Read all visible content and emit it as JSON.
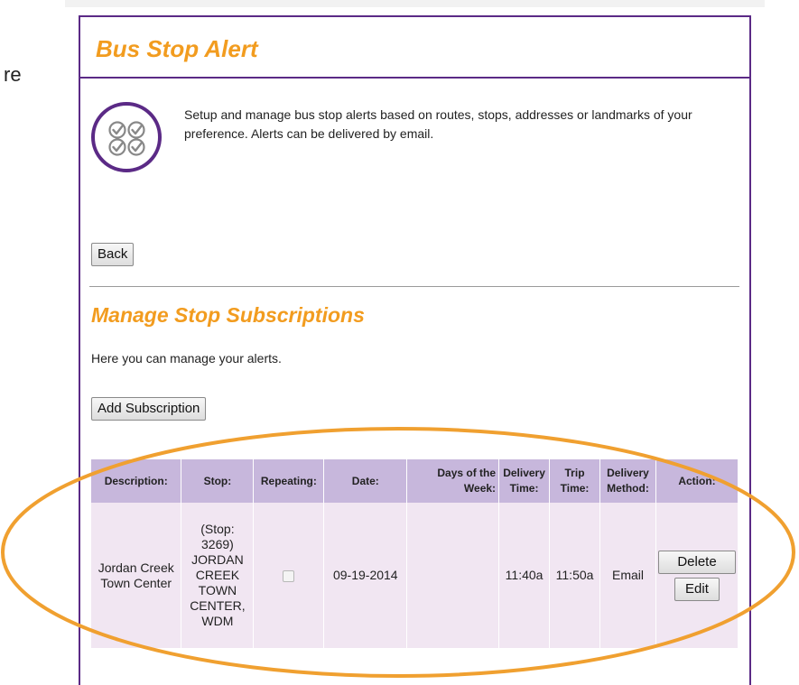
{
  "page": {
    "left_fragment": "re",
    "title": "Bus Stop Alert",
    "intro_text": "Setup and manage bus stop alerts based on routes, stops, addresses or landmarks of your preference. Alerts can be delivered by email.",
    "back_label": "Back",
    "section_title": "Manage Stop Subscriptions",
    "section_text": "Here you can manage your alerts.",
    "add_label": "Add Subscription"
  },
  "table": {
    "headers": [
      "Description:",
      "Stop:",
      "Repeating:",
      "Date:",
      "Days of the Week:",
      "Delivery Time:",
      "Trip Time:",
      "Delivery Method:",
      "Action:"
    ],
    "rows": [
      {
        "description": "Jordan Creek Town Center",
        "stop": "(Stop: 3269) JORDAN CREEK TOWN CENTER, WDM",
        "repeating": false,
        "date": "09-19-2014",
        "days": "",
        "delivery_time": "11:40a",
        "trip_time": "11:50a",
        "method": "Email",
        "delete_label": "Delete",
        "edit_label": "Edit"
      }
    ]
  },
  "colors": {
    "accent_orange": "#f29c1f",
    "brand_purple": "#5b2a86",
    "header_bg": "#c7b7dc",
    "row_bg": "#f1e6f2",
    "annotation": "#f0a030"
  },
  "icons": {
    "logo": "check-circles-icon"
  }
}
